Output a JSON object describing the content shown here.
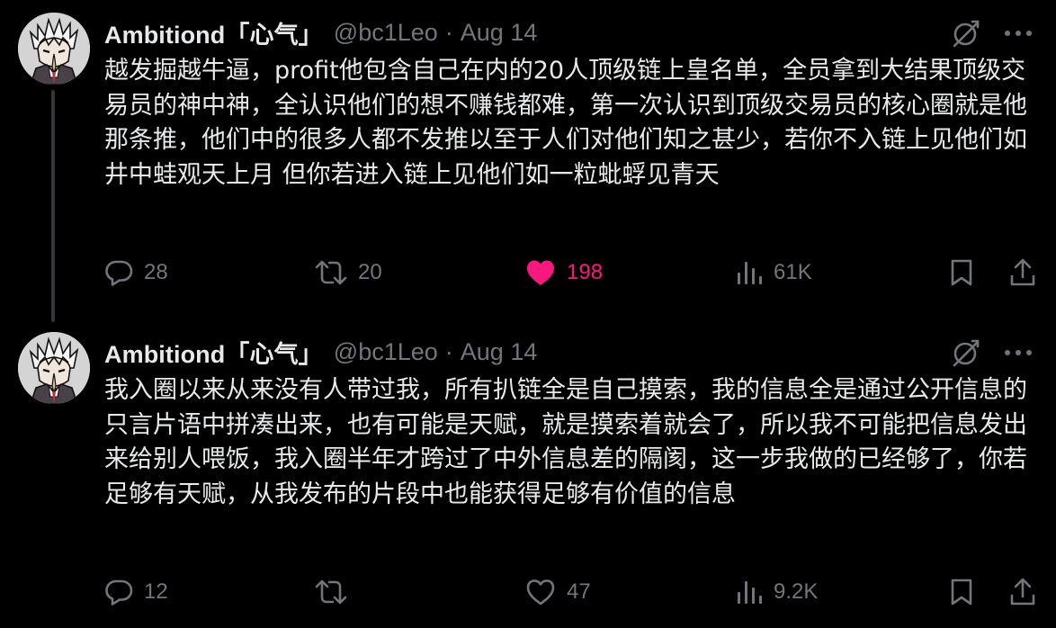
{
  "colors": {
    "background": "#000000",
    "text_primary": "#e7e9ea",
    "text_secondary": "#71767b",
    "like_active": "#f91880",
    "thread_line": "#333639"
  },
  "tweets": [
    {
      "author": {
        "display_name": "Ambitiond「心气」",
        "handle": "@bc1Leo",
        "avatar_icon": "anime-character-avatar"
      },
      "separator": "·",
      "date": "Aug 14",
      "text": "越发掘越牛逼，profit他包含自己在内的20人顶级链上皇名单，全员拿到大结果顶级交易员的神中神，全认识他们的想不赚钱都难，第一次认识到顶级交易员的核心圈就是他那条推，他们中的很多人都不发推以至于人们对他们知之甚少，若你不入链上见他们如井中蛙观天上月 但你若进入链上见他们如一粒蚍蜉见青天",
      "stats": {
        "replies": "28",
        "reposts": "20",
        "likes": "198",
        "views": "61K"
      },
      "liked": true
    },
    {
      "author": {
        "display_name": "Ambitiond「心气」",
        "handle": "@bc1Leo",
        "avatar_icon": "anime-character-avatar"
      },
      "separator": "·",
      "date": "Aug 14",
      "text": "我入圈以来从来没有人带过我，所有扒链全是自己摸索，我的信息全是通过公开信息的只言片语中拼凑出来，也有可能是天赋，就是摸索着就会了，所以我不可能把信息发出来给别人喂饭，我入圈半年才跨过了中外信息差的隔阂，这一步我做的已经够了，你若足够有天赋，从我发布的片段中也能获得足够有价值的信息",
      "stats": {
        "replies": "12",
        "reposts": "",
        "likes": "47",
        "views": "9.2K"
      },
      "liked": false
    }
  ]
}
